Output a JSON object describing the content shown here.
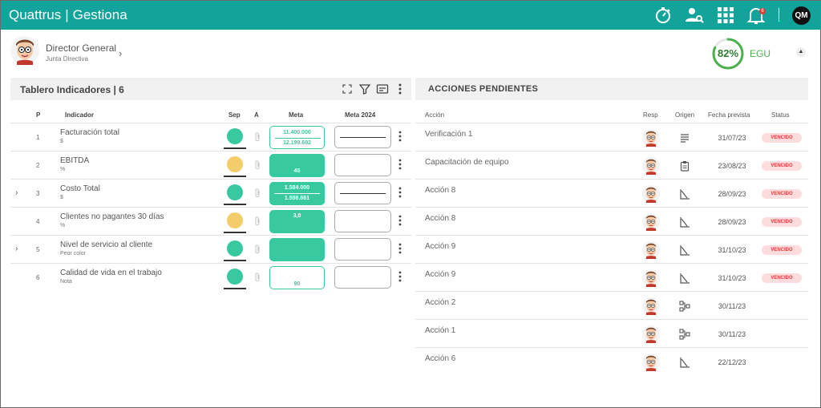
{
  "app": {
    "brand_left": "Quattrus",
    "brand_sep": "|",
    "brand_right": "Gestiona",
    "user_initials": "QM",
    "notification_count": "6"
  },
  "user": {
    "role": "Director General",
    "department": "Junta Directiva"
  },
  "egu": {
    "percent_label": "82%",
    "value": 0.82,
    "label": "EGU"
  },
  "colors": {
    "accent": "#12a39b",
    "green": "#38c9a0",
    "yellow": "#f3cd6b",
    "vencido_bg": "#fcdcdc",
    "vencido_text": "#e53935"
  },
  "indicators_panel": {
    "title": "Tablero Indicadores | 6",
    "headers": {
      "p": "P",
      "indicador": "Indicador",
      "sep": "Sep",
      "a": "A",
      "meta": "Meta",
      "meta2024": "Meta 2024"
    },
    "rows": [
      {
        "p": "1",
        "name": "Facturación total",
        "unit": "$",
        "sep_color": "#38c9a0",
        "meta_style": "outline",
        "meta_top": "11.400.000",
        "meta_bottom": "12.199.692",
        "meta2024_line": true,
        "expandable": false
      },
      {
        "p": "2",
        "name": "EBITDA",
        "unit": "%",
        "sep_color": "#f3cd6b",
        "meta_style": "filled",
        "meta_top": "",
        "meta_bottom": "45",
        "meta2024_line": false,
        "expandable": false
      },
      {
        "p": "3",
        "name": "Costo Total",
        "unit": "$",
        "sep_color": "#38c9a0",
        "meta_style": "filled",
        "meta_top": "1.584.000",
        "meta_bottom": "1.598.661",
        "meta2024_line": true,
        "expandable": true
      },
      {
        "p": "4",
        "name": "Clientes no pagantes 30 días",
        "unit": "%",
        "sep_color": "#f3cd6b",
        "meta_style": "filled",
        "meta_top": "3,0",
        "meta_bottom": "",
        "meta2024_line": false,
        "expandable": false
      },
      {
        "p": "5",
        "name": "Nivel de servicio al cliente",
        "unit": "Peor color",
        "sep_color": "#38c9a0",
        "meta_style": "filled",
        "meta_top": "",
        "meta_bottom": "",
        "meta2024_line": false,
        "expandable": true
      },
      {
        "p": "6",
        "name": "Calidad de vida en el trabajo",
        "unit": "Nota",
        "sep_color": "#38c9a0",
        "meta_style": "outline",
        "meta_top": "",
        "meta_bottom": "90",
        "meta2024_line": false,
        "expandable": false
      }
    ]
  },
  "actions_panel": {
    "title": "ACCIONES PENDIENTES",
    "headers": {
      "accion": "Acción",
      "resp": "Resp",
      "origen": "Origen",
      "fecha": "Fecha prevista",
      "status": "Status"
    },
    "rows": [
      {
        "name": "Verificación 1",
        "origin_icon": "list-icon",
        "date": "31/07/23",
        "status": "VENCIDO"
      },
      {
        "name": "Capacitación de equipo",
        "origin_icon": "clipboard-icon",
        "date": "23/08/23",
        "status": "VENCIDO"
      },
      {
        "name": "Acción 8",
        "origin_icon": "chart-icon",
        "date": "28/09/23",
        "status": "VENCIDO"
      },
      {
        "name": "Acción 8",
        "origin_icon": "chart-icon",
        "date": "28/09/23",
        "status": "VENCIDO"
      },
      {
        "name": "Acción 9",
        "origin_icon": "chart-icon",
        "date": "31/10/23",
        "status": "VENCIDO"
      },
      {
        "name": "Acción 9",
        "origin_icon": "chart-icon",
        "date": "31/10/23",
        "status": "VENCIDO"
      },
      {
        "name": "Acción 2",
        "origin_icon": "process-icon",
        "date": "30/11/23",
        "status": ""
      },
      {
        "name": "Acción 1",
        "origin_icon": "process-icon",
        "date": "30/11/23",
        "status": ""
      },
      {
        "name": "Acción 6",
        "origin_icon": "chart-icon",
        "date": "22/12/23",
        "status": ""
      }
    ]
  }
}
